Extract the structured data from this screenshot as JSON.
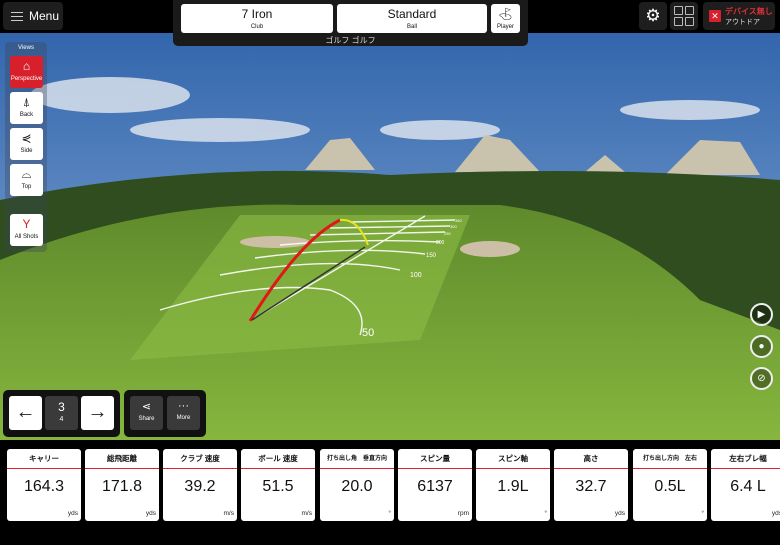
{
  "header": {
    "menu_label": "Menu",
    "club_value": "7 Iron",
    "club_label": "Club",
    "ball_value": "Standard",
    "ball_label": "Ball",
    "player_label": "Player",
    "game_name": "ゴルフ ゴルフ",
    "device_line1": "デバイス無し",
    "device_line2": "アウトドア",
    "settings_icon": "gear-icon",
    "layout_icon": "grid-icon"
  },
  "views": {
    "title": "Views",
    "items": [
      {
        "label": "Perspective",
        "icon": "perspective-icon",
        "active": true
      },
      {
        "label": "Back",
        "icon": "back-view-icon"
      },
      {
        "label": "Side",
        "icon": "side-view-icon"
      },
      {
        "label": "Top",
        "icon": "top-view-icon"
      },
      {
        "label": "All Shots",
        "icon": "all-shots-icon"
      }
    ]
  },
  "shot_nav": {
    "current": "3",
    "total": "4",
    "share_label": "Share",
    "more_label": "More"
  },
  "range": {
    "distance_labels": [
      "50",
      "100",
      "150",
      "200",
      "250",
      "300",
      "350"
    ],
    "trajectory_color": "#e01818",
    "landing_color": "#e8e020"
  },
  "stats": [
    {
      "label": "キャリー",
      "value": "164.3",
      "unit": "yds"
    },
    {
      "label": "総飛距離",
      "value": "171.8",
      "unit": "yds"
    },
    {
      "label": "クラブ 速度",
      "value": "39.2",
      "unit": "m/s"
    },
    {
      "label": "ボール 速度",
      "value": "51.5",
      "unit": "m/s"
    },
    {
      "label": "打ち出し角　垂直方向",
      "value": "20.0",
      "unit": "°"
    },
    {
      "label": "スピン量",
      "value": "6137",
      "unit": "rpm"
    },
    {
      "label": "スピン軸",
      "value": "1.9L",
      "unit": "°"
    },
    {
      "label": "高さ",
      "value": "32.7",
      "unit": "yds"
    },
    {
      "label": "打ち出し方向　左右",
      "value": "0.5L",
      "unit": "°"
    },
    {
      "label": "左右ブレ幅",
      "value": "6.4 L",
      "unit": "yds"
    }
  ],
  "colors": {
    "accent": "#d8202c",
    "sky_top": "#2a5fa8",
    "fairway": "#7fae3a"
  }
}
